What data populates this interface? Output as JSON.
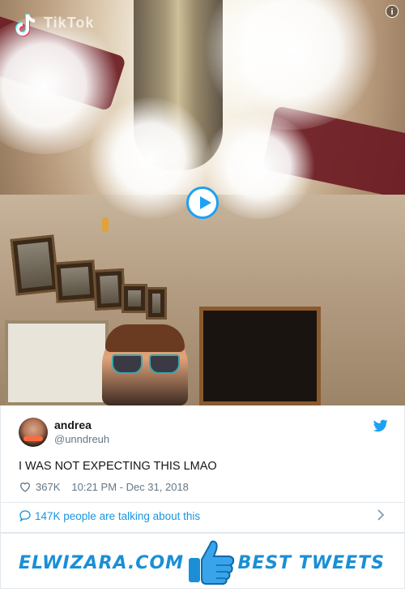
{
  "media": {
    "app_logo": "tiktok-logo",
    "app_word": "TikTok",
    "info_symbol": "i",
    "play_icon": "play-icon"
  },
  "tweet": {
    "name": "andrea",
    "handle": "@unndreuh",
    "text": "I WAS NOT EXPECTING THIS LMAO",
    "likes": "367K",
    "timestamp": "10:21 PM - Dec 31, 2018",
    "talking": "147K people are talking about this",
    "brand_color": "#1da1f2"
  },
  "banner": {
    "site": "ELWIZARA.COM",
    "tagline": "BEST TWEETS",
    "accent": "#1a8fd6"
  }
}
